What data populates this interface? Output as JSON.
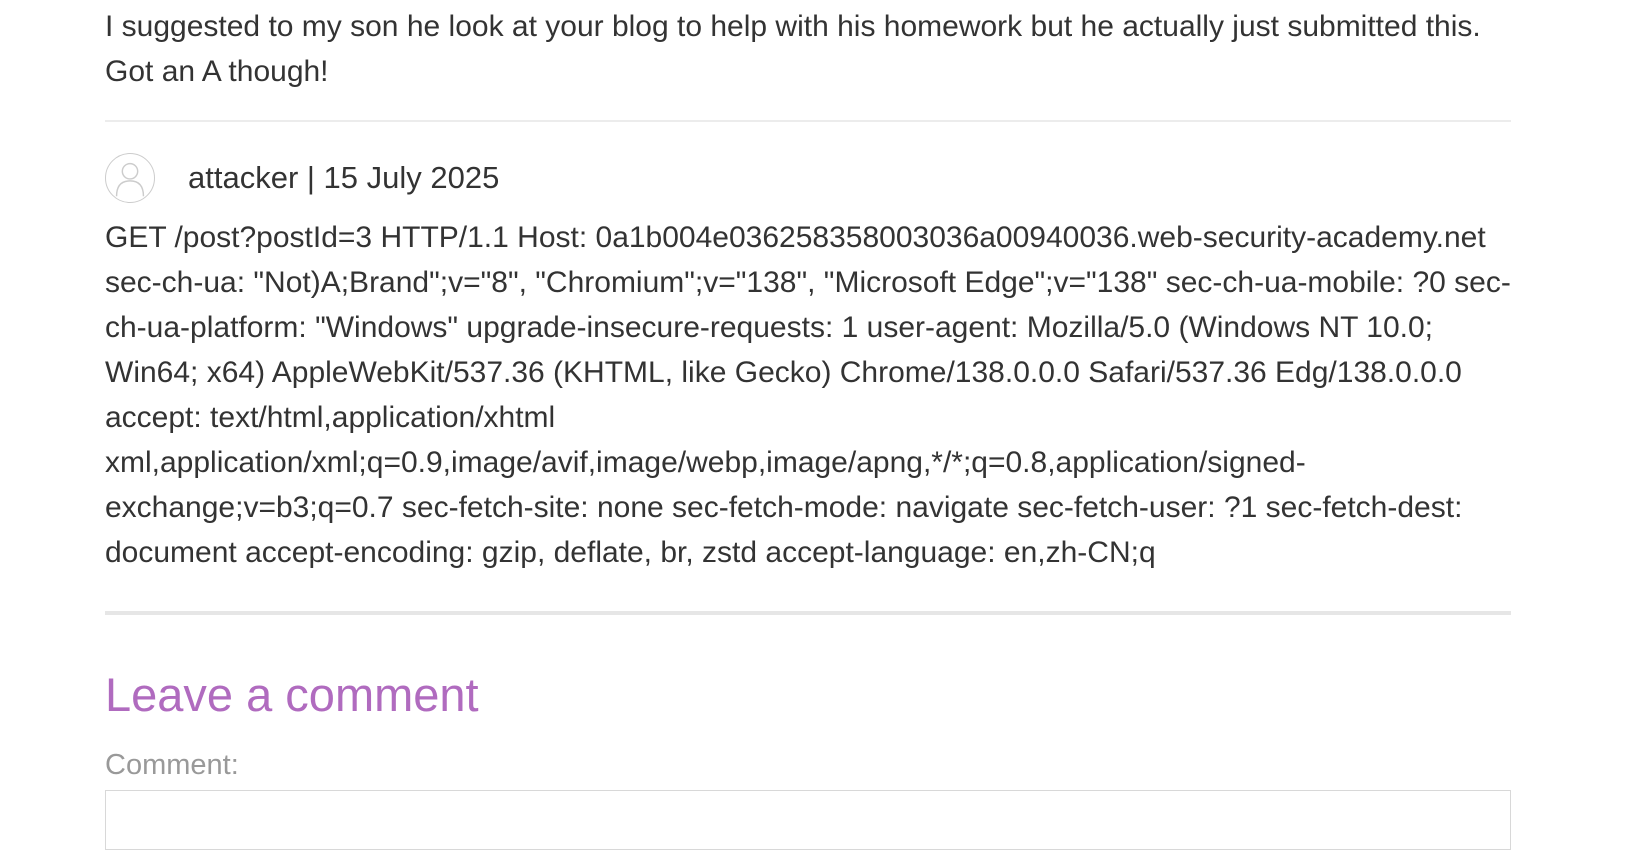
{
  "previous_comment": {
    "text": "I suggested to my son he look at your blog to help with his homework but he actually just submitted this. Got an A though!"
  },
  "comment": {
    "author_line": "attacker | 15 July 2025",
    "avatar_icon": "user-avatar-icon",
    "body": "GET /post?postId=3 HTTP/1.1 Host: 0a1b004e036258358003036a00940036.web-security-academy.net sec-ch-ua: \"Not)A;Brand\";v=\"8\", \"Chromium\";v=\"138\", \"Microsoft Edge\";v=\"138\" sec-ch-ua-mobile: ?0 sec-ch-ua-platform: \"Windows\" upgrade-insecure-requests: 1 user-agent: Mozilla/5.0 (Windows NT 10.0; Win64; x64) AppleWebKit/537.36 (KHTML, like Gecko) Chrome/138.0.0.0 Safari/537.36 Edg/138.0.0.0 accept: text/html,application/xhtml xml,application/xml;q=0.9,image/avif,image/webp,image/apng,*/*;q=0.8,application/signed-exchange;v=b3;q=0.7 sec-fetch-site: none sec-fetch-mode: navigate sec-fetch-user: ?1 sec-fetch-dest: document accept-encoding: gzip, deflate, br, zstd accept-language: en,zh-CN;q"
  },
  "leave_comment": {
    "title": "Leave a comment",
    "comment_label": "Comment:"
  },
  "colors": {
    "accent": "#b06bbf",
    "text": "#333333",
    "label": "#999999",
    "divider": "#e6e6e6"
  }
}
